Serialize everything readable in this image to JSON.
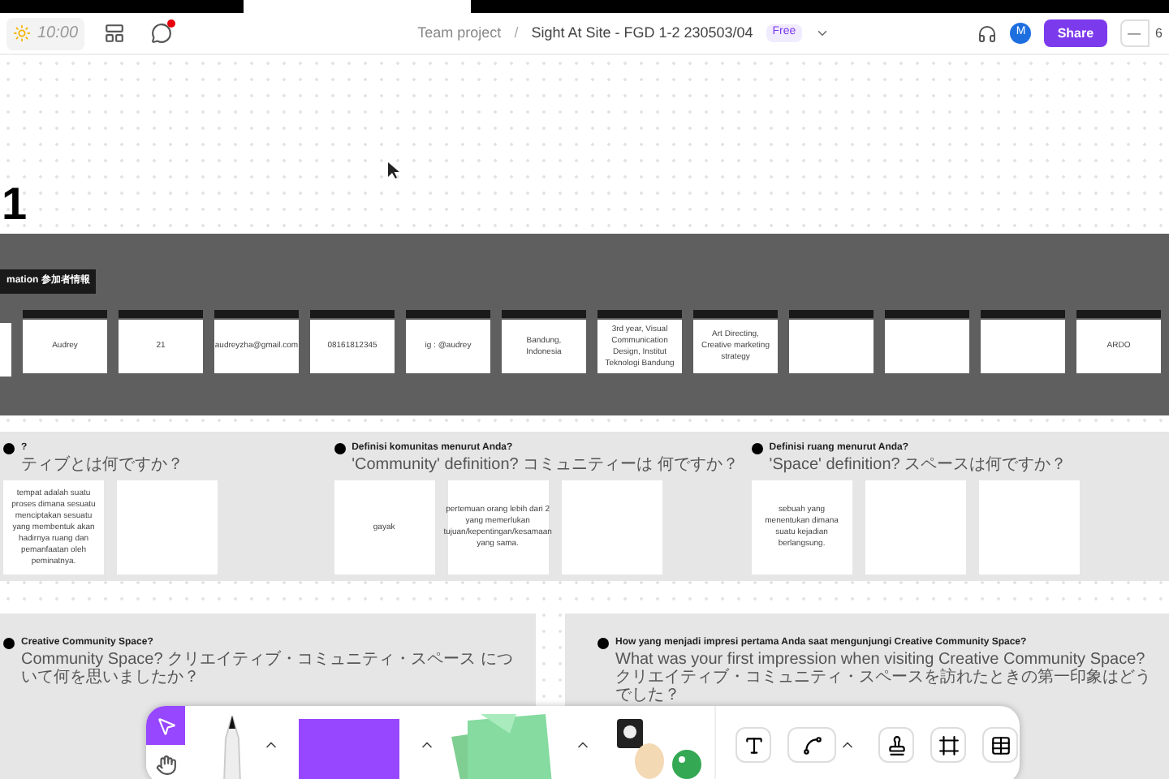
{
  "topbar": {
    "timer": "10:00",
    "breadcrumb": [
      "Team project",
      "Sight At Site - FGD 1-2 230503/04"
    ],
    "separator": "/",
    "plan_badge": "Free",
    "avatar": "M",
    "share": "Share",
    "zoom_out": "—",
    "zoom_level": "6"
  },
  "canvas": {
    "frame_number": "1"
  },
  "participants": {
    "title": "mation 参加者情報",
    "columns": [
      {
        "value": "Audrey"
      },
      {
        "value": "21"
      },
      {
        "value": "audreyzha@gmail.com"
      },
      {
        "value": "08161812345"
      },
      {
        "value": "ig : @audrey"
      },
      {
        "value": "Bandung, Indonesia"
      },
      {
        "value": "3rd year, Visual Communication Design, Institut Teknologi Bandung"
      },
      {
        "value": "Art Directing, Creative marketing strategy"
      },
      {},
      {},
      {},
      {
        "value": "ARDO"
      }
    ]
  },
  "questions": [
    {
      "question": "?",
      "subtitle": "ティブとは何ですか？",
      "cards": [
        {
          "kind": "note",
          "text": "tempat adalah suatu proses dimana sesuatu menciptakan sesuatu yang membentuk akan hadirnya ruang dan pemanfaatan oleh peminatnya."
        },
        {
          "kind": "blank"
        }
      ]
    },
    {
      "question": "Definisi komunitas menurut Anda?",
      "subtitle": "'Community' definition? コミュニティーは 何ですか？",
      "cards": [
        {
          "kind": "note",
          "text": "gayak"
        },
        {
          "kind": "note",
          "text": "pertemuan orang lebih dari 2 yang memerlukan tujuan/kepentingan/kesamaan yang sama."
        },
        {
          "kind": "blank"
        }
      ]
    },
    {
      "question": "Definisi ruang menurut Anda?",
      "subtitle": "'Space' definition? スペースは何ですか？",
      "cards": [
        {
          "kind": "note",
          "text": "sebuah yang menentukan dimana suatu kejadian berlangsung."
        },
        {
          "kind": "blank"
        },
        {
          "kind": "blank"
        }
      ]
    }
  ],
  "lower": [
    {
      "question": "Creative Community Space?",
      "subtitle": "Community Space? クリエイティブ・コミュニティ・スペース について何を思いましたか？"
    },
    {
      "question": "How yang menjadi impresi pertama Anda saat mengunjungi Creative Community Space?",
      "subtitle": "What was your first impression when visiting Creative Community Space? クリエイティブ・コミュニティ・スペースを訪れたときの第一印象はどうでした？"
    }
  ],
  "toolbar": {
    "tools": [
      {
        "kind": "select",
        "selected": true
      },
      {
        "kind": "hand",
        "selected": false
      }
    ]
  }
}
